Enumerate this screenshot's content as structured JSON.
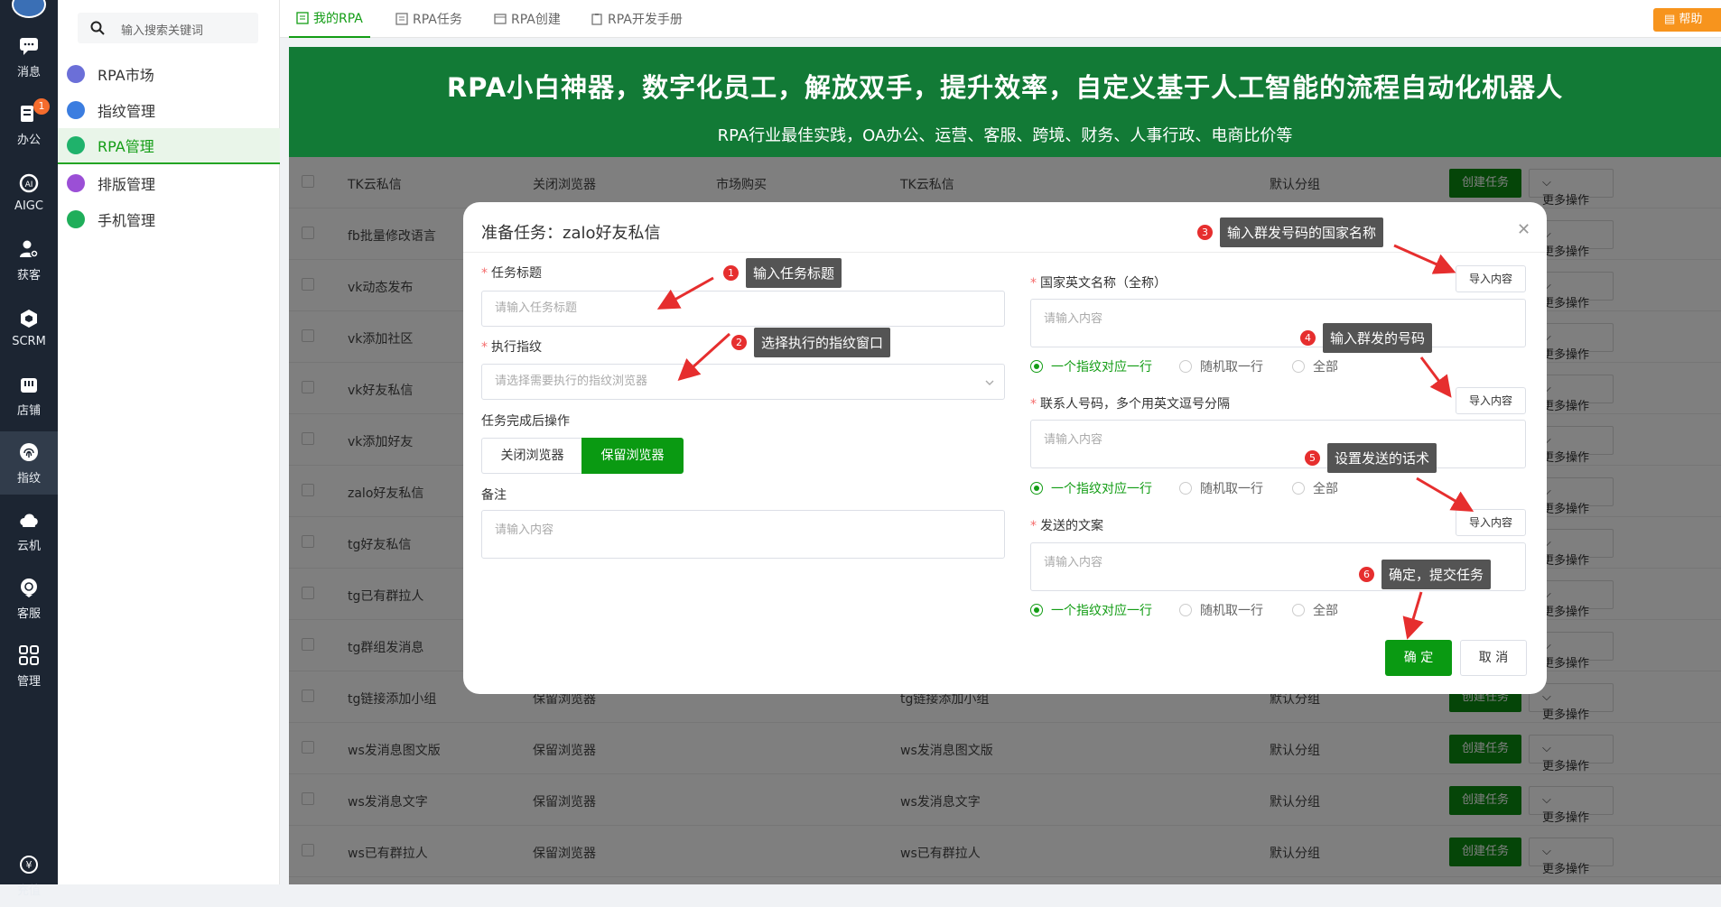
{
  "rail": {
    "items": [
      {
        "label": "消息",
        "icon": "chat-icon"
      },
      {
        "label": "办公",
        "icon": "office-icon",
        "badge": "1"
      },
      {
        "label": "AIGC",
        "icon": "ai-icon"
      },
      {
        "label": "获客",
        "icon": "user-add-icon"
      },
      {
        "label": "SCRM",
        "icon": "cube-icon"
      },
      {
        "label": "店铺",
        "icon": "shop-icon"
      },
      {
        "label": "指纹",
        "icon": "fingerprint-icon",
        "active": true
      },
      {
        "label": "云机",
        "icon": "cloud-icon"
      },
      {
        "label": "客服",
        "icon": "support-icon"
      },
      {
        "label": "管理",
        "icon": "grid-icon"
      },
      {
        "label": "充值",
        "icon": "recharge-icon"
      }
    ]
  },
  "menu": {
    "search_placeholder": "输入搜索关键词",
    "items": [
      {
        "label": "RPA市场",
        "color": "#6b6fd8"
      },
      {
        "label": "指纹管理",
        "color": "#3b7de0"
      },
      {
        "label": "RPA管理",
        "color": "#1fb26b",
        "active": true
      },
      {
        "label": "排版管理",
        "color": "#9b4fd6"
      },
      {
        "label": "手机管理",
        "color": "#1fae5a"
      }
    ]
  },
  "tabs": [
    {
      "label": "我的RPA",
      "active": true
    },
    {
      "label": "RPA任务"
    },
    {
      "label": "RPA创建"
    },
    {
      "label": "RPA开发手册"
    }
  ],
  "help_label": "帮助",
  "banner": {
    "title": "RPA小白神器，数字化员工，解放双手，提升效率，自定义基于人工智能的流程自动化机器人",
    "subtitle": "RPA行业最佳实践，OA办公、运营、客服、跨境、财务、人事行政、电商比价等",
    "bg_color": "#127a36"
  },
  "table": {
    "create_label": "创建任务",
    "more_label": "更多操作",
    "rows": [
      {
        "name": "TK云私信",
        "after": "关闭浏览器",
        "category": "市场购买",
        "desc": "TK云私信",
        "group": "默认分组"
      },
      {
        "name": "fb批量修改语言",
        "after": "",
        "category": "",
        "desc": "",
        "group": ""
      },
      {
        "name": "vk动态发布",
        "after": "",
        "category": "",
        "desc": "",
        "group": ""
      },
      {
        "name": "vk添加社区",
        "after": "",
        "category": "",
        "desc": "",
        "group": ""
      },
      {
        "name": "vk好友私信",
        "after": "",
        "category": "",
        "desc": "",
        "group": ""
      },
      {
        "name": "vk添加好友",
        "after": "",
        "category": "",
        "desc": "",
        "group": ""
      },
      {
        "name": "zalo好友私信",
        "after": "",
        "category": "",
        "desc": "",
        "group": ""
      },
      {
        "name": "tg好友私信",
        "after": "",
        "category": "",
        "desc": "",
        "group": ""
      },
      {
        "name": "tg已有群拉人",
        "after": "",
        "category": "",
        "desc": "",
        "group": ""
      },
      {
        "name": "tg群组发消息",
        "after": "",
        "category": "",
        "desc": "",
        "group": ""
      },
      {
        "name": "tg链接添加小组",
        "after": "保留浏览器",
        "category": "",
        "desc": "tg链接添加小组",
        "group": "默认分组"
      },
      {
        "name": "ws发消息图文版",
        "after": "保留浏览器",
        "category": "",
        "desc": "ws发消息图文版",
        "group": "默认分组"
      },
      {
        "name": "ws发消息文字",
        "after": "保留浏览器",
        "category": "",
        "desc": "ws发消息文字",
        "group": "默认分组"
      },
      {
        "name": "ws已有群拉人",
        "after": "保留浏览器",
        "category": "",
        "desc": "ws已有群拉人",
        "group": "默认分组"
      }
    ]
  },
  "modal": {
    "title": "准备任务：zalo好友私信",
    "task_title_label": "任务标题",
    "task_title_placeholder": "请输入任务标题",
    "exec_fp_label": "执行指纹",
    "exec_fp_placeholder": "请选择需要执行的指纹浏览器",
    "after_label": "任务完成后操作",
    "after_close": "关闭浏览器",
    "after_keep": "保留浏览器",
    "remark_label": "备注",
    "remark_placeholder": "请输入内容",
    "country_label": "国家英文名称（全称）",
    "country_placeholder": "请输入内容",
    "contacts_label": "联系人号码，多个用英文逗号分隔",
    "contacts_placeholder": "请输入内容",
    "message_label": "发送的文案",
    "message_placeholder": "请输入内容",
    "import_label": "导入内容",
    "radio_options": [
      "一个指纹对应一行",
      "随机取一行",
      "全部"
    ],
    "ok_label": "确 定",
    "cancel_label": "取 消"
  },
  "tips": [
    {
      "num": "1",
      "text": "输入任务标题"
    },
    {
      "num": "2",
      "text": "选择执行的指纹窗口"
    },
    {
      "num": "3",
      "text": "输入群发号码的国家名称"
    },
    {
      "num": "4",
      "text": "输入群发的号码"
    },
    {
      "num": "5",
      "text": "设置发送的话术"
    },
    {
      "num": "6",
      "text": "确定，提交任务"
    }
  ]
}
